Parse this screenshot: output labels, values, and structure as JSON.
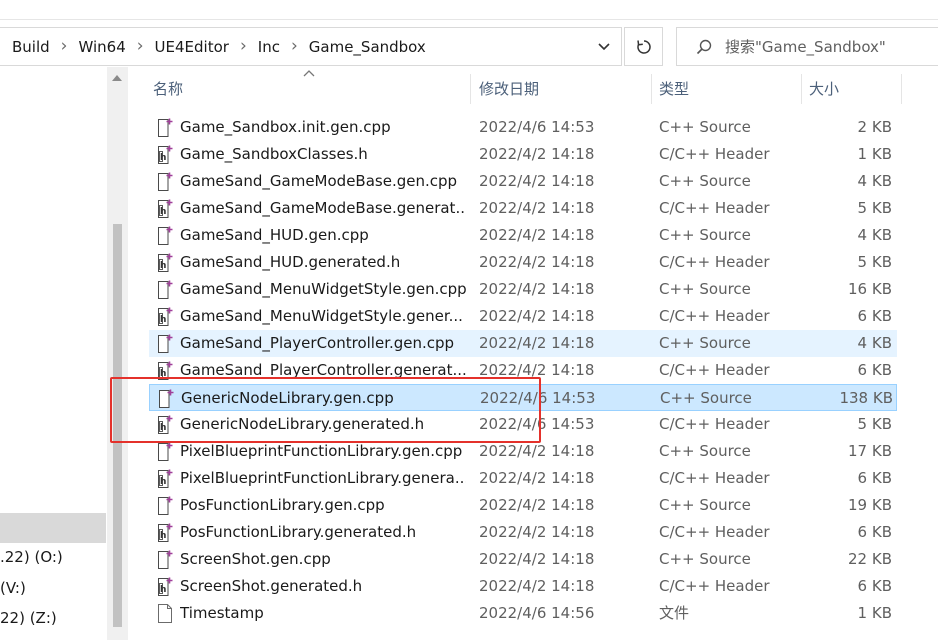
{
  "breadcrumb": [
    "Build",
    "Win64",
    "UE4Editor",
    "Inc",
    "Game_Sandbox"
  ],
  "search": {
    "placeholder": "搜索\"Game_Sandbox\""
  },
  "nav": {
    "items": [
      {
        "label": ".22) (O:)"
      },
      {
        "label": "(V:)"
      },
      {
        "label": "22) (Z:)"
      }
    ]
  },
  "columns": {
    "name": "名称",
    "date": "修改日期",
    "type": "类型",
    "size": "大小"
  },
  "files": [
    {
      "name": "Game_Sandbox.init.gen.cpp",
      "date": "2022/4/6 14:53",
      "type": "C++ Source",
      "size": "2 KB",
      "icon": "cpp-file-icon",
      "state": ""
    },
    {
      "name": "Game_SandboxClasses.h",
      "date": "2022/4/2 14:18",
      "type": "C/C++ Header",
      "size": "1 KB",
      "icon": "header-file-icon",
      "state": ""
    },
    {
      "name": "GameSand_GameModeBase.gen.cpp",
      "date": "2022/4/2 14:18",
      "type": "C++ Source",
      "size": "4 KB",
      "icon": "cpp-file-icon",
      "state": ""
    },
    {
      "name": "GameSand_GameModeBase.generat...",
      "date": "2022/4/2 14:18",
      "type": "C/C++ Header",
      "size": "5 KB",
      "icon": "header-file-icon",
      "state": ""
    },
    {
      "name": "GameSand_HUD.gen.cpp",
      "date": "2022/4/2 14:18",
      "type": "C++ Source",
      "size": "4 KB",
      "icon": "cpp-file-icon",
      "state": ""
    },
    {
      "name": "GameSand_HUD.generated.h",
      "date": "2022/4/2 14:18",
      "type": "C/C++ Header",
      "size": "5 KB",
      "icon": "header-file-icon",
      "state": ""
    },
    {
      "name": "GameSand_MenuWidgetStyle.gen.cpp",
      "date": "2022/4/2 14:18",
      "type": "C++ Source",
      "size": "16 KB",
      "icon": "cpp-file-icon",
      "state": ""
    },
    {
      "name": "GameSand_MenuWidgetStyle.gener...",
      "date": "2022/4/2 14:18",
      "type": "C/C++ Header",
      "size": "6 KB",
      "icon": "header-file-icon",
      "state": ""
    },
    {
      "name": "GameSand_PlayerController.gen.cpp",
      "date": "2022/4/2 14:18",
      "type": "C++ Source",
      "size": "4 KB",
      "icon": "cpp-file-icon",
      "state": "hover"
    },
    {
      "name": "GameSand_PlayerController.generat...",
      "date": "2022/4/2 14:18",
      "type": "C/C++ Header",
      "size": "6 KB",
      "icon": "header-file-icon",
      "state": ""
    },
    {
      "name": "GenericNodeLibrary.gen.cpp",
      "date": "2022/4/6 14:53",
      "type": "C++ Source",
      "size": "138 KB",
      "icon": "cpp-file-icon",
      "state": "selected"
    },
    {
      "name": "GenericNodeLibrary.generated.h",
      "date": "2022/4/6 14:53",
      "type": "C/C++ Header",
      "size": "5 KB",
      "icon": "header-file-icon",
      "state": ""
    },
    {
      "name": "PixelBlueprintFunctionLibrary.gen.cpp",
      "date": "2022/4/2 14:18",
      "type": "C++ Source",
      "size": "17 KB",
      "icon": "cpp-file-icon",
      "state": ""
    },
    {
      "name": "PixelBlueprintFunctionLibrary.genera...",
      "date": "2022/4/2 14:18",
      "type": "C/C++ Header",
      "size": "6 KB",
      "icon": "header-file-icon",
      "state": ""
    },
    {
      "name": "PosFunctionLibrary.gen.cpp",
      "date": "2022/4/2 14:18",
      "type": "C++ Source",
      "size": "19 KB",
      "icon": "cpp-file-icon",
      "state": ""
    },
    {
      "name": "PosFunctionLibrary.generated.h",
      "date": "2022/4/2 14:18",
      "type": "C/C++ Header",
      "size": "6 KB",
      "icon": "header-file-icon",
      "state": ""
    },
    {
      "name": "ScreenShot.gen.cpp",
      "date": "2022/4/2 14:18",
      "type": "C++ Source",
      "size": "22 KB",
      "icon": "cpp-file-icon",
      "state": ""
    },
    {
      "name": "ScreenShot.generated.h",
      "date": "2022/4/2 14:18",
      "type": "C/C++ Header",
      "size": "6 KB",
      "icon": "header-file-icon",
      "state": ""
    },
    {
      "name": "Timestamp",
      "date": "2022/4/6 14:56",
      "type": "文件",
      "size": "1 KB",
      "icon": "generic-file-icon",
      "state": ""
    }
  ],
  "colors": {
    "selection": "#cce8ff",
    "hover": "#e5f3ff",
    "highlight_box": "#e4312b"
  }
}
